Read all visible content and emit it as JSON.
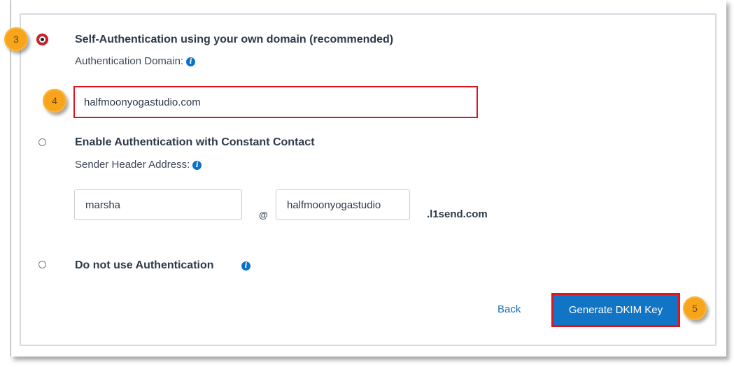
{
  "options": [
    {
      "title": "Self-Authentication using your own domain (recommended)",
      "selected": true,
      "sublabel": "Authentication Domain:",
      "field_value": "halfmoonyogastudio.com"
    },
    {
      "title": "Enable Authentication with Constant Contact",
      "selected": false,
      "sublabel": "Sender Header Address:",
      "local_part_value": "marsha",
      "at_symbol": "@",
      "domain_part_value": "halfmoonyogastudio",
      "suffix": ".l1send.com"
    },
    {
      "title": "Do not use Authentication",
      "selected": false
    }
  ],
  "info_icon_glyph": "i",
  "actions": {
    "back_label": "Back",
    "generate_label": "Generate DKIM Key"
  },
  "step_markers": [
    "3",
    "4",
    "5"
  ],
  "colors": {
    "highlight": "#e0141e",
    "primary_button": "#1274c4",
    "link": "#1a6fb5",
    "step_marker": "#f8a51b",
    "info_icon": "#0b72c7"
  }
}
